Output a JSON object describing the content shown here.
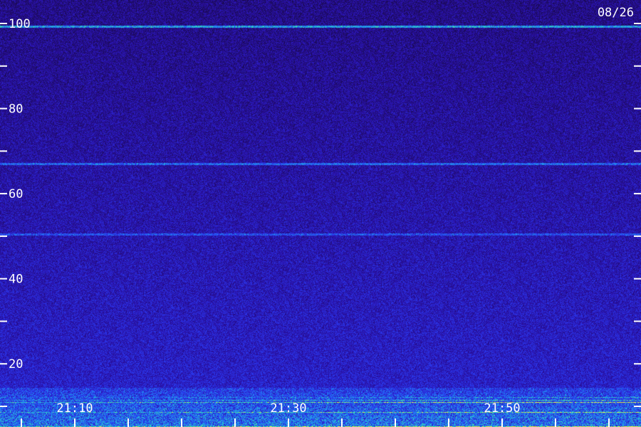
{
  "chart_data": {
    "type": "heatmap",
    "date_label": "08/26",
    "y_axis": {
      "range": [
        0,
        100
      ],
      "ticks": [
        10,
        20,
        30,
        40,
        50,
        60,
        70,
        80,
        90,
        100
      ],
      "tick_labels": [
        "20",
        "40",
        "60",
        "80",
        "100"
      ],
      "tick_label_values": [
        20,
        40,
        60,
        80,
        100
      ]
    },
    "x_axis": {
      "range": [
        "21:03",
        "22:03"
      ],
      "tick_labels": [
        "21:10",
        "21:30",
        "21:50"
      ],
      "major_ticks": [
        "21:05",
        "21:10",
        "21:15",
        "21:20",
        "21:25",
        "21:30",
        "21:35",
        "21:40",
        "21:45",
        "21:50",
        "21:55",
        "22:00"
      ]
    },
    "grid": false,
    "colormap": [
      "#1a0a52",
      "#2a10a8",
      "#2a3af0",
      "#1ea0f0",
      "#3cf0a0",
      "#f0f040"
    ],
    "features": [
      {
        "kind": "horizontal_line",
        "y": 99.3,
        "intensity": 0.55
      },
      {
        "kind": "horizontal_line",
        "y": 67,
        "intensity": 0.35
      },
      {
        "kind": "horizontal_line",
        "y": 50.5,
        "intensity": 0.25
      },
      {
        "kind": "band",
        "y_min": 0,
        "y_max": 14.5,
        "intensity": 0.75
      }
    ]
  }
}
